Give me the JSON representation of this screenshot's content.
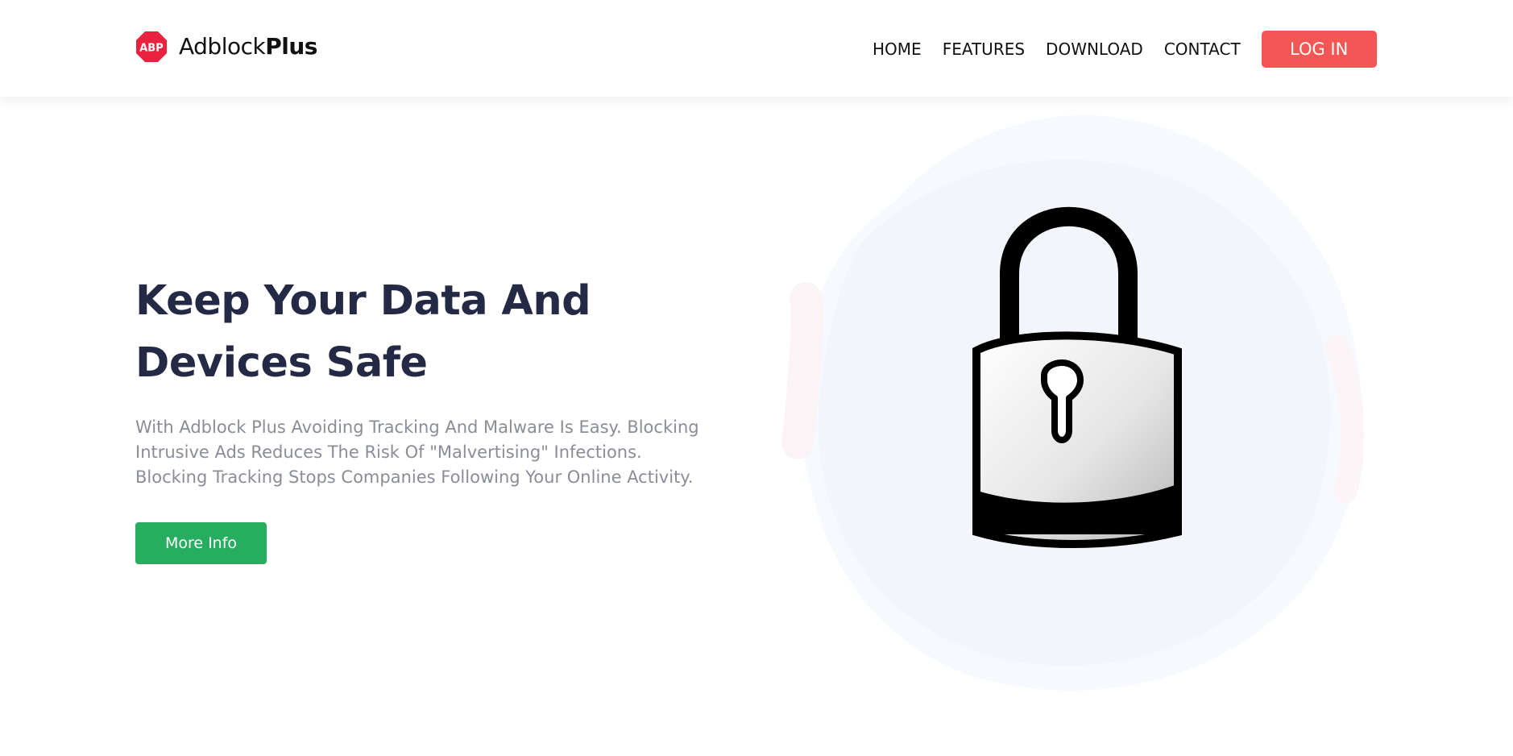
{
  "brand": {
    "logo_badge": "ABP",
    "name_regular": "Adblock",
    "name_bold": "Plus",
    "logo_color": "#e8223f"
  },
  "nav": {
    "items": [
      {
        "label": "HOME"
      },
      {
        "label": "FEATURES"
      },
      {
        "label": "DOWNLOAD"
      },
      {
        "label": "CONTACT"
      }
    ],
    "login_label": "LOG IN",
    "login_color": "#f45656"
  },
  "hero": {
    "title": "Keep Your Data And Devices Safe",
    "description": "With Adblock Plus Avoiding Tracking And Malware Is Easy. Blocking Intrusive Ads Reduces The Risk Of \"Malvertising\" Infections. Blocking Tracking Stops Companies Following Your Online Activity.",
    "button_label": "More Info",
    "button_color": "#26ad5f",
    "illustration_icon": "padlock-icon"
  }
}
